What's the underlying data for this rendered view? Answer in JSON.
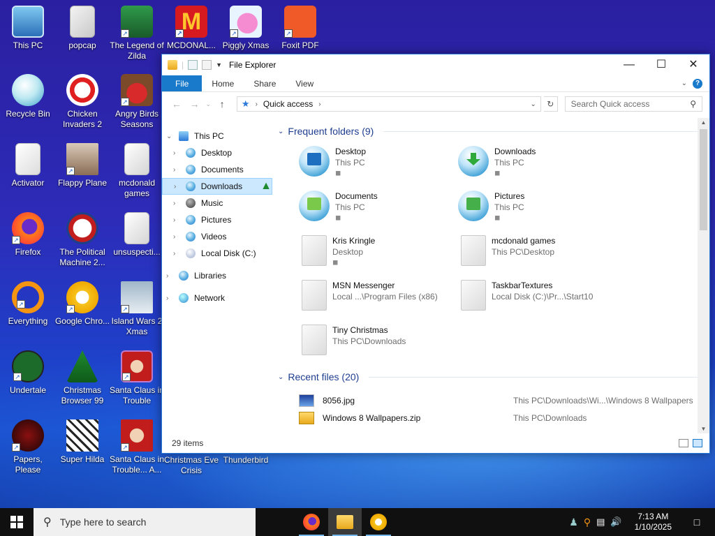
{
  "desktop": {
    "icons": [
      {
        "label": "This PC"
      },
      {
        "label": "popcap"
      },
      {
        "label": "The Legend of Zilda"
      },
      {
        "label": "MCDONAL..."
      },
      {
        "label": "Piggly Xmas"
      },
      {
        "label": "Foxit PDF"
      },
      {
        "label": "Recycle Bin"
      },
      {
        "label": "Chicken Invaders 2"
      },
      {
        "label": "Angry Birds Seasons"
      },
      {
        "label": "Activator"
      },
      {
        "label": "Flappy Plane"
      },
      {
        "label": "mcdonald games"
      },
      {
        "label": "Firefox"
      },
      {
        "label": "The Political Machine 2..."
      },
      {
        "label": "unsuspecti..."
      },
      {
        "label": "Everything"
      },
      {
        "label": "Google Chro..."
      },
      {
        "label": "Island Wars 2 Xmas"
      },
      {
        "label": "Undertale"
      },
      {
        "label": "Christmas Browser 99"
      },
      {
        "label": "Santa Claus in Trouble"
      },
      {
        "label": "Papers, Please"
      },
      {
        "label": "Super Hilda"
      },
      {
        "label": "Santa Claus in Trouble... A..."
      },
      {
        "label": "Christmas Eve Crisis"
      },
      {
        "label": "Thunderbird"
      }
    ]
  },
  "explorer": {
    "title": "File Explorer",
    "ribbon_tabs": {
      "file": "File",
      "home": "Home",
      "share": "Share",
      "view": "View"
    },
    "help": "?",
    "address": {
      "location": "Quick access"
    },
    "search": {
      "placeholder": "Search Quick access"
    },
    "nav": {
      "this_pc": "This PC",
      "desktop": "Desktop",
      "documents": "Documents",
      "downloads": "Downloads",
      "music": "Music",
      "pictures": "Pictures",
      "videos": "Videos",
      "local_disk": "Local Disk (C:)",
      "libraries": "Libraries",
      "network": "Network"
    },
    "frequent": {
      "header": "Frequent folders (9)",
      "items": [
        {
          "name": "Desktop",
          "location": "This PC"
        },
        {
          "name": "Downloads",
          "location": "This PC"
        },
        {
          "name": "Documents",
          "location": "This PC"
        },
        {
          "name": "Pictures",
          "location": "This PC"
        },
        {
          "name": "Kris Kringle",
          "location": "Desktop"
        },
        {
          "name": "mcdonald games",
          "location": "This PC\\Desktop"
        },
        {
          "name": "MSN Messenger",
          "location": "Local ...\\Program Files (x86)"
        },
        {
          "name": "TaskbarTextures",
          "location": "Local Disk (C:)\\Pr...\\Start10"
        },
        {
          "name": "Tiny Christmas",
          "location": "This PC\\Downloads"
        }
      ]
    },
    "recent": {
      "header": "Recent files (20)",
      "items": [
        {
          "name": "8056.jpg",
          "path": "This PC\\Downloads\\Wi...\\Windows 8 Wallpapers"
        },
        {
          "name": "Windows 8 Wallpapers.zip",
          "path": "This PC\\Downloads"
        }
      ]
    },
    "status": {
      "count": "29 items"
    }
  },
  "taskbar": {
    "search_placeholder": "Type here to search",
    "time": "7:13 AM",
    "date": "1/10/2025"
  }
}
